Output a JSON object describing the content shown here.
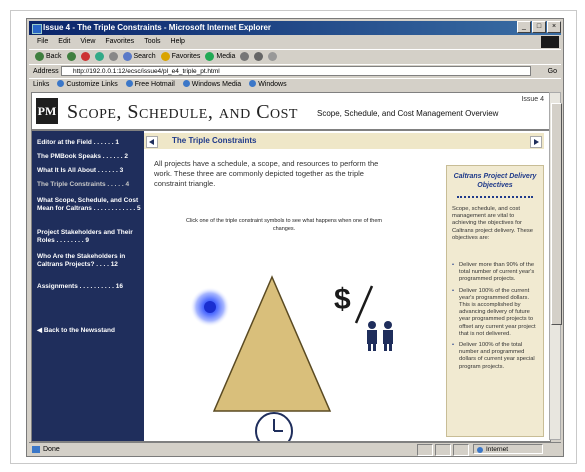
{
  "browser": {
    "title": "Issue 4 - The Triple Constraints - Microsoft Internet Explorer",
    "menu": [
      "File",
      "Edit",
      "View",
      "Favorites",
      "Tools",
      "Help"
    ],
    "toolbar": [
      "Back",
      "Search",
      "Favorites",
      "Media"
    ],
    "address_label": "Address",
    "address_value": "http://192.0.0.1:12/ecsc/issue4/pl_e4_triple_pt.html",
    "go_label": "Go",
    "links": [
      "Customize Links",
      "Free Hotmail",
      "Windows Media",
      "Windows"
    ],
    "status_text": "Done",
    "zone_text": "Internet"
  },
  "page": {
    "logo": "PM",
    "title": "Scope, Schedule, and Cost",
    "subtitle": "Scope, Schedule, and Cost Management Overview",
    "issue": "Issue 4",
    "nav": [
      "Editor at the Field . . . . . . 1",
      "The PMBook Speaks . . . . . . 2",
      "What It Is All About . . . . . . 3",
      "The Triple Constraints . . . . . 4",
      "What Scope, Schedule, and Cost Mean for Caltrans . . . . . . . . . . . . 5",
      "Project Stakeholders and Their Roles . . . . . . . . 9",
      "Who Are the Stakeholders in Caltrans Projects? . . . . 12",
      "Assignments . . . . . . . . . . 16",
      "Back to the Newsstand"
    ],
    "section_title": "The Triple Constraints",
    "intro": "All projects have a schedule, a scope, and resources to perform the work. These three are commonly depicted together as the triple constraint triangle.",
    "click_text": "Click one of the triple constraint symbols to see what happens when one of them changes.",
    "money_symbol": "$",
    "sidebar": {
      "title": "Caltrans Project Delivery Objectives",
      "body": "Scope, schedule, and cost management are vital to achieving the objectives for Caltrans project delivery. These objectives are:",
      "bullets": [
        "Deliver more than 90% of the total number of current year's programmed projects.",
        "Deliver 100% of the current year's programmed dollars. This is accomplished by advancing delivery of future year programmed projects to offset any current year project that is not delivered.",
        "Deliver 100% of the total number and programmed dollars of current year special program projects."
      ]
    }
  },
  "colors": {
    "nav_bg": "#1f2e5c",
    "section_bg": "#efe7c8",
    "triangle": "#d9bf7b",
    "accent": "#1f3a8a"
  }
}
